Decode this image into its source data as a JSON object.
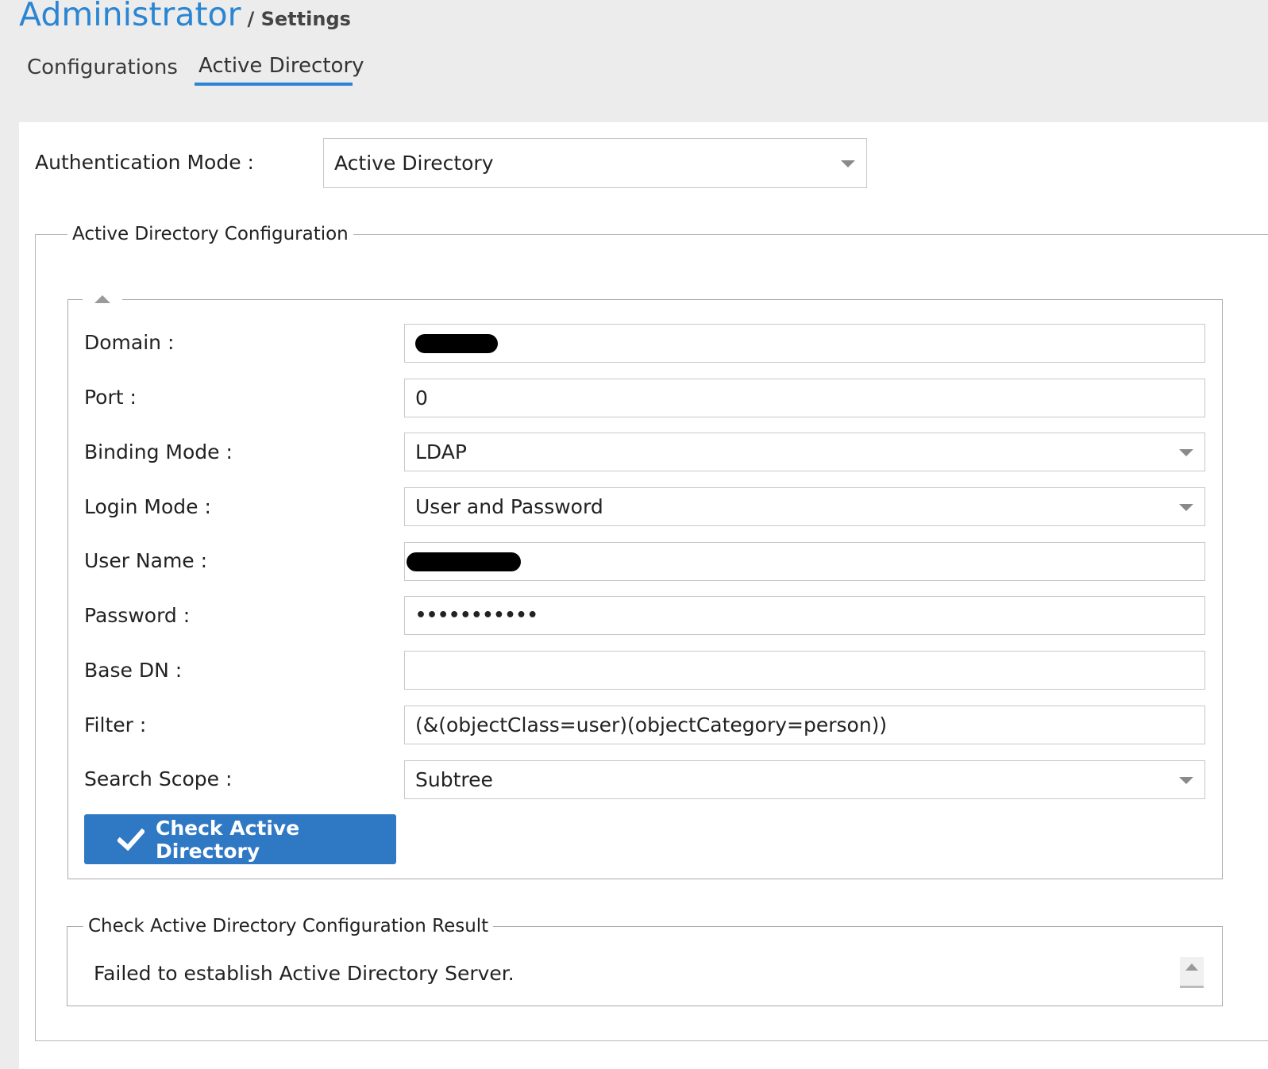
{
  "header": {
    "title": "Administrator",
    "subtitle": "/ Settings"
  },
  "tabs": [
    {
      "label": "Configurations",
      "active": false
    },
    {
      "label": "Active Directory",
      "active": true
    }
  ],
  "auth": {
    "label": "Authentication Mode :",
    "value": "Active Directory"
  },
  "ad_config": {
    "legend": "Active Directory Configuration",
    "collapse_icon": "chevron-up-icon",
    "fields": {
      "domain": {
        "label": "Domain :",
        "value": ""
      },
      "port": {
        "label": "Port :",
        "value": "0"
      },
      "binding_mode": {
        "label": "Binding Mode :",
        "value": "LDAP"
      },
      "login_mode": {
        "label": "Login Mode :",
        "value": "User and Password"
      },
      "user_name": {
        "label": "User Name :",
        "value": ""
      },
      "password": {
        "label": "Password :",
        "value": "•••••••••••"
      },
      "base_dn": {
        "label": "Base DN :",
        "value": ""
      },
      "filter": {
        "label": "Filter :",
        "value": "(&(objectClass=user)(objectCategory=person))"
      },
      "search_scope": {
        "label": "Search Scope :",
        "value": "Subtree"
      }
    },
    "check_button": {
      "label": "Check Active Directory",
      "icon": "checkmark-icon"
    }
  },
  "result": {
    "legend": "Check Active Directory Configuration Result",
    "message": "Failed to establish Active Directory Server."
  },
  "colors": {
    "accent": "#2a85d3",
    "button": "#2f78c4",
    "page_bg": "#ececec"
  }
}
